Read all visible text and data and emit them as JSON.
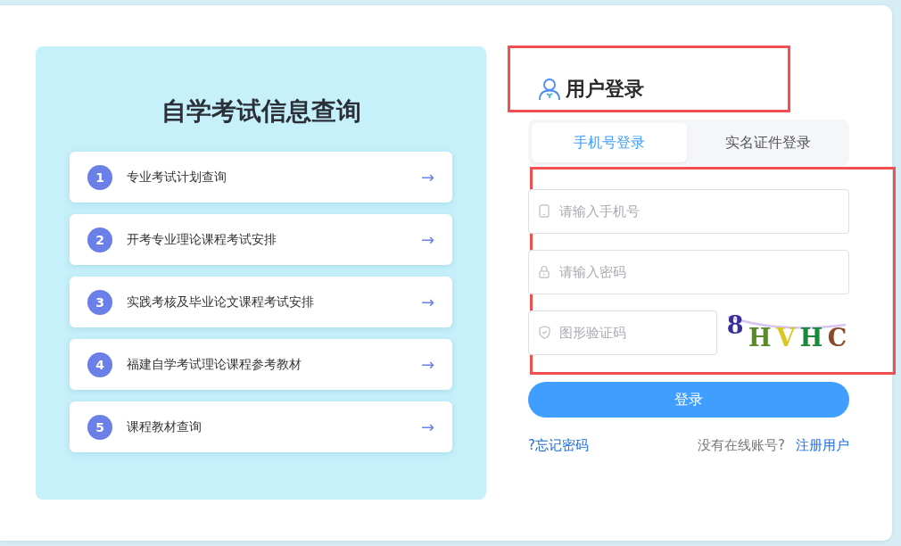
{
  "query_panel": {
    "title": "自学考试信息查询",
    "items": [
      {
        "number": "1",
        "label": "专业考试计划查询",
        "arrow": "→"
      },
      {
        "number": "2",
        "label": "开考专业理论课程考试安排",
        "arrow": "→"
      },
      {
        "number": "3",
        "label": "实践考核及毕业论文课程考试安排",
        "arrow": "→"
      },
      {
        "number": "4",
        "label": "福建自学考试理论课程参考教材",
        "arrow": "→"
      },
      {
        "number": "5",
        "label": "课程教材查询",
        "arrow": "→"
      }
    ]
  },
  "login": {
    "title": "用户登录",
    "tabs": [
      {
        "label": "手机号登录",
        "selected": true
      },
      {
        "label": "实名证件登录",
        "selected": false
      }
    ],
    "fields": [
      {
        "kind": "phone",
        "placeholder": "请输入手机号"
      },
      {
        "kind": "password",
        "placeholder": "请输入密码"
      }
    ],
    "captcha_field": {
      "placeholder": "图形验证码"
    },
    "captcha": {
      "text": "8HVHC"
    },
    "submit": "登录",
    "forgot": "?忘记密码",
    "no_account": "没有在线账号?",
    "register": "注册用户"
  }
}
